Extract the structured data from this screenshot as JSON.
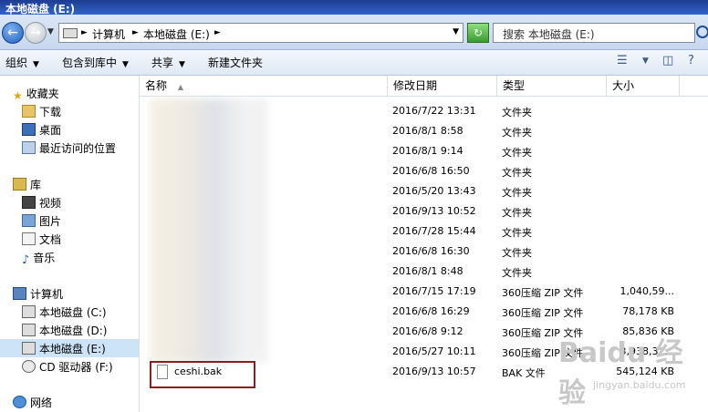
{
  "window": {
    "title": "本地磁盘 (E:)"
  },
  "address": {
    "crumbs": [
      "计算机",
      "本地磁盘 (E:)"
    ],
    "search_placeholder": "搜索 本地磁盘 (E:)"
  },
  "toolbar": {
    "organize": "组织",
    "include_in_library": "包含到库中",
    "share": "共享",
    "new_folder": "新建文件夹"
  },
  "sidebar": {
    "favorites": {
      "label": "收藏夹",
      "items": [
        "下载",
        "桌面",
        "最近访问的位置"
      ]
    },
    "libraries": {
      "label": "库",
      "items": [
        "视频",
        "图片",
        "文档",
        "音乐"
      ]
    },
    "computer": {
      "label": "计算机",
      "items": [
        "本地磁盘 (C:)",
        "本地磁盘 (D:)",
        "本地磁盘 (E:)",
        "CD 驱动器 (F:)"
      ],
      "selected_index": 2
    },
    "network": {
      "label": "网络"
    }
  },
  "columns": [
    "名称",
    "修改日期",
    "类型",
    "大小"
  ],
  "files": [
    {
      "name": "",
      "date": "2016/7/22 13:31",
      "type": "文件夹",
      "size": ""
    },
    {
      "name": "",
      "date": "2016/8/1 8:58",
      "type": "文件夹",
      "size": ""
    },
    {
      "name": "",
      "date": "2016/8/1 9:14",
      "type": "文件夹",
      "size": ""
    },
    {
      "name": "",
      "date": "2016/6/8 16:50",
      "type": "文件夹",
      "size": ""
    },
    {
      "name": "",
      "date": "2016/5/20 13:43",
      "type": "文件夹",
      "size": ""
    },
    {
      "name": "",
      "date": "2016/9/13 10:52",
      "type": "文件夹",
      "size": ""
    },
    {
      "name": "",
      "date": "2016/7/28 15:44",
      "type": "文件夹",
      "size": ""
    },
    {
      "name": "",
      "date": "2016/6/8 16:30",
      "type": "文件夹",
      "size": ""
    },
    {
      "name": "",
      "date": "2016/8/1 8:48",
      "type": "文件夹",
      "size": ""
    },
    {
      "name": "",
      "date": "2016/7/15 17:19",
      "type": "360压缩 ZIP 文件",
      "size": "1,040,59..."
    },
    {
      "name": "",
      "date": "2016/6/8 16:29",
      "type": "360压缩 ZIP 文件",
      "size": "78,178 KB"
    },
    {
      "name": "",
      "date": "2016/6/8 9:12",
      "type": "360压缩 ZIP 文件",
      "size": "85,836 KB"
    },
    {
      "name": "",
      "date": "2016/5/27 10:11",
      "type": "360压缩 ZIP 文件",
      "size": "3,938,32..."
    },
    {
      "name": "ceshi.bak",
      "date": "2016/9/13 10:57",
      "type": "BAK 文件",
      "size": "545,124 KB"
    }
  ],
  "watermark": {
    "brand": "Baidu 经验",
    "url": "jingyan.baidu.com"
  }
}
